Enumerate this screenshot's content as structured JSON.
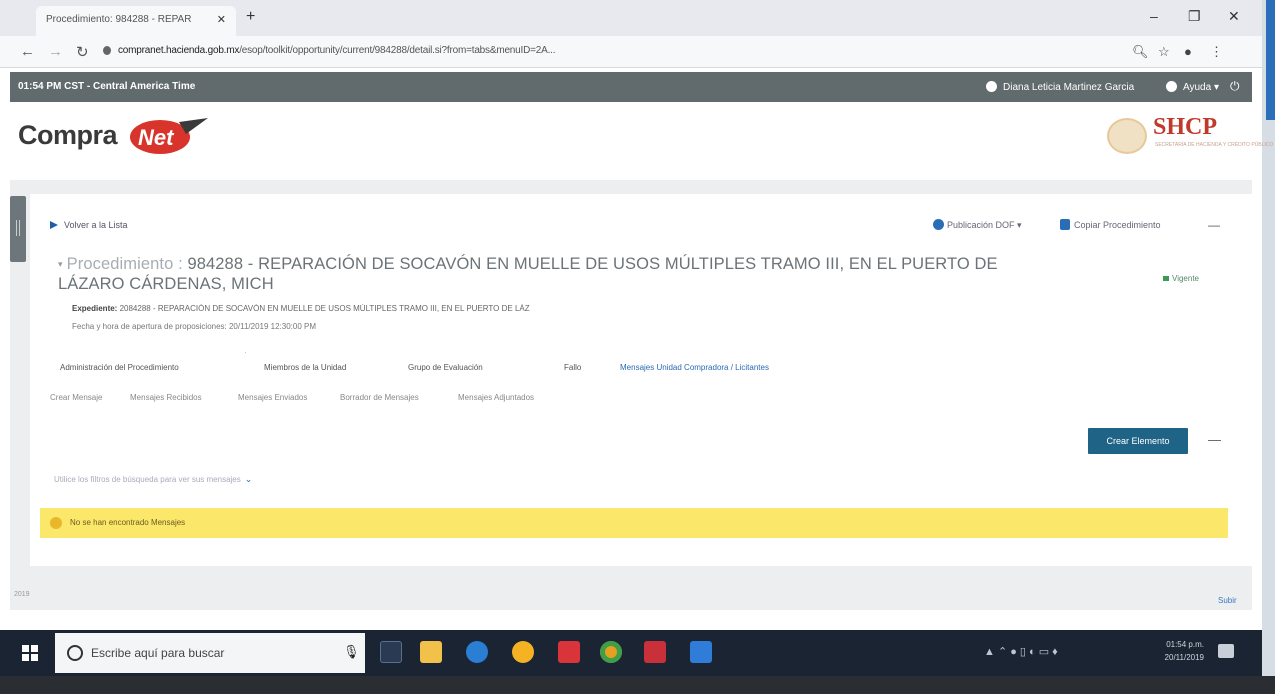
{
  "browser": {
    "tab_title": "Procedimiento: 984288 - REPAR",
    "new_tab": "+",
    "url_domain": "compranet.hacienda.gob.mx",
    "url_rest": "/esop/toolkit/opportunity/current/984288/detail.si?from=tabs&menuID=2A..."
  },
  "site": {
    "time": "01:54 PM CST - Central America Time",
    "user": "Diana Leticia Martinez Garcia",
    "help": "Ayuda",
    "logo_compra": "Compra",
    "logo_net": "Net",
    "shcp": "SHCP",
    "shcp_sub": "SECRETARÍA DE HACIENDA Y CRÉDITO PÚBLICO"
  },
  "main": {
    "back_link": "Volver a la Lista",
    "pub_link": "Publicación DOF",
    "copy_link": "Copiar Procedimiento",
    "title_prefix": "Procedimiento : ",
    "title_main": "984288 - REPARACIÓN DE SOCAVÓN EN MUELLE DE USOS MÚLTIPLES TRAMO III, EN EL PUERTO DE LÁZARO CÁRDENAS, MICH",
    "status": "Vigente",
    "expediente_label": "Expediente:",
    "expediente_value": "2084288 - REPARACIÓN DE SOCAVÓN EN MUELLE DE USOS MÚLTIPLES TRAMO III, EN EL PUERTO DE LÁZ",
    "fecha": "Fecha y hora de apertura de proposiciones: 20/11/2019 12:30:00 PM",
    "tabs": [
      {
        "label": "Administración del Procedimiento"
      },
      {
        "label": "Miembros de la Unidad"
      },
      {
        "label": "Grupo de Evaluación"
      },
      {
        "label": "Fallo"
      },
      {
        "label": "Mensajes Unidad Compradora / Licitantes"
      }
    ],
    "subtabs": [
      {
        "label": "Crear Mensaje"
      },
      {
        "label": "Mensajes Recibidos"
      },
      {
        "label": "Mensajes Enviados"
      },
      {
        "label": "Borrador de Mensajes"
      },
      {
        "label": "Mensajes Adjuntados"
      }
    ],
    "create_button": "Crear Elemento",
    "filter": "Utilice los filtros de búsqueda para ver sus mensajes",
    "alert": "No se han encontrado Mensajes",
    "footer_left": "2019",
    "footer_right": "Subir"
  },
  "taskbar": {
    "search_placeholder": "Escribe aquí para buscar",
    "clock_time": "01:54 p.m.",
    "clock_date": "20/11/2019"
  },
  "colors": {
    "header_bar": "#616a6c",
    "accent_blue": "#2a6bb4",
    "button": "#1f6386",
    "alert": "#fbe76a",
    "shcp_red": "#c0392b"
  }
}
